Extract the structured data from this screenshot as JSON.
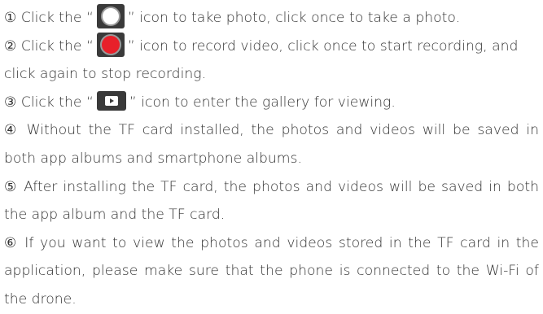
{
  "steps": {
    "s1": {
      "before": "① Click the “",
      "after": "” icon to take photo, click once to take a photo.",
      "icon": "shutter-icon"
    },
    "s2": {
      "before": "② Click the “",
      "after": "” icon to record video, click once to start recording, and",
      "cont": "click again to stop recording.",
      "icon": "record-icon",
      "icon_color": "#e8202a"
    },
    "s3": {
      "before": "③ Click the “",
      "after": "” icon to enter the gallery for viewing.",
      "icon": "gallery-play-icon"
    },
    "s4": {
      "line1": "④ Without the TF card installed, the photos and videos will be saved in",
      "line2": "both app albums and smartphone albums."
    },
    "s5": {
      "line1": "⑤ After installing the TF card, the photos and videos will be saved in both",
      "line2": "the app album and the TF card."
    },
    "s6": {
      "line1": "⑥ If you want to view the photos and videos stored in the TF card in the",
      "line2": "application, please make sure that the phone is connected to the Wi-Fi of",
      "line3": "the drone."
    }
  }
}
